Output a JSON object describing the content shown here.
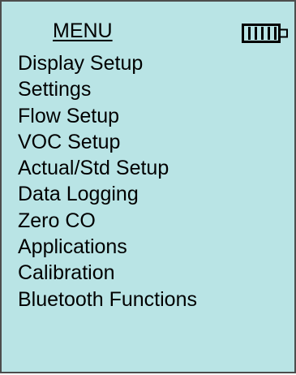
{
  "header": {
    "title": "MENU",
    "battery": {
      "icon": "battery-full-icon",
      "level": 1.0
    }
  },
  "menu": {
    "items": [
      {
        "label": "Display Setup"
      },
      {
        "label": "Settings"
      },
      {
        "label": "Flow Setup"
      },
      {
        "label": "VOC Setup"
      },
      {
        "label": "Actual/Std Setup"
      },
      {
        "label": "Data Logging"
      },
      {
        "label": "Zero CO"
      },
      {
        "label": "Applications"
      },
      {
        "label": "Calibration"
      },
      {
        "label": "Bluetooth Functions"
      }
    ]
  },
  "colors": {
    "background": "#b9e4e5",
    "border": "#4d4d4d",
    "text": "#000000"
  }
}
